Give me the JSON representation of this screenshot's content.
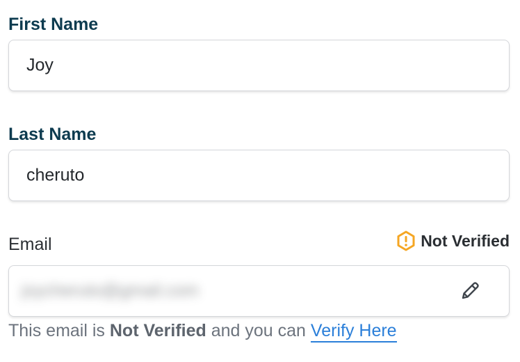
{
  "first_name": {
    "label": "First Name",
    "value": "Joy"
  },
  "last_name": {
    "label": "Last Name",
    "value": "cheruto"
  },
  "email": {
    "label": "Email",
    "value_redacted": "joycheruto@gmail.com",
    "status_label": "Not Verified",
    "status_color": "#f5a623",
    "edit_icon": "pencil-icon",
    "status_icon": "warning-hexagon-icon",
    "helper_prefix": "This email is ",
    "helper_bold": "Not Verified",
    "helper_middle": " and you can ",
    "helper_link": "Verify Here",
    "link_color": "#2b7fd9"
  }
}
